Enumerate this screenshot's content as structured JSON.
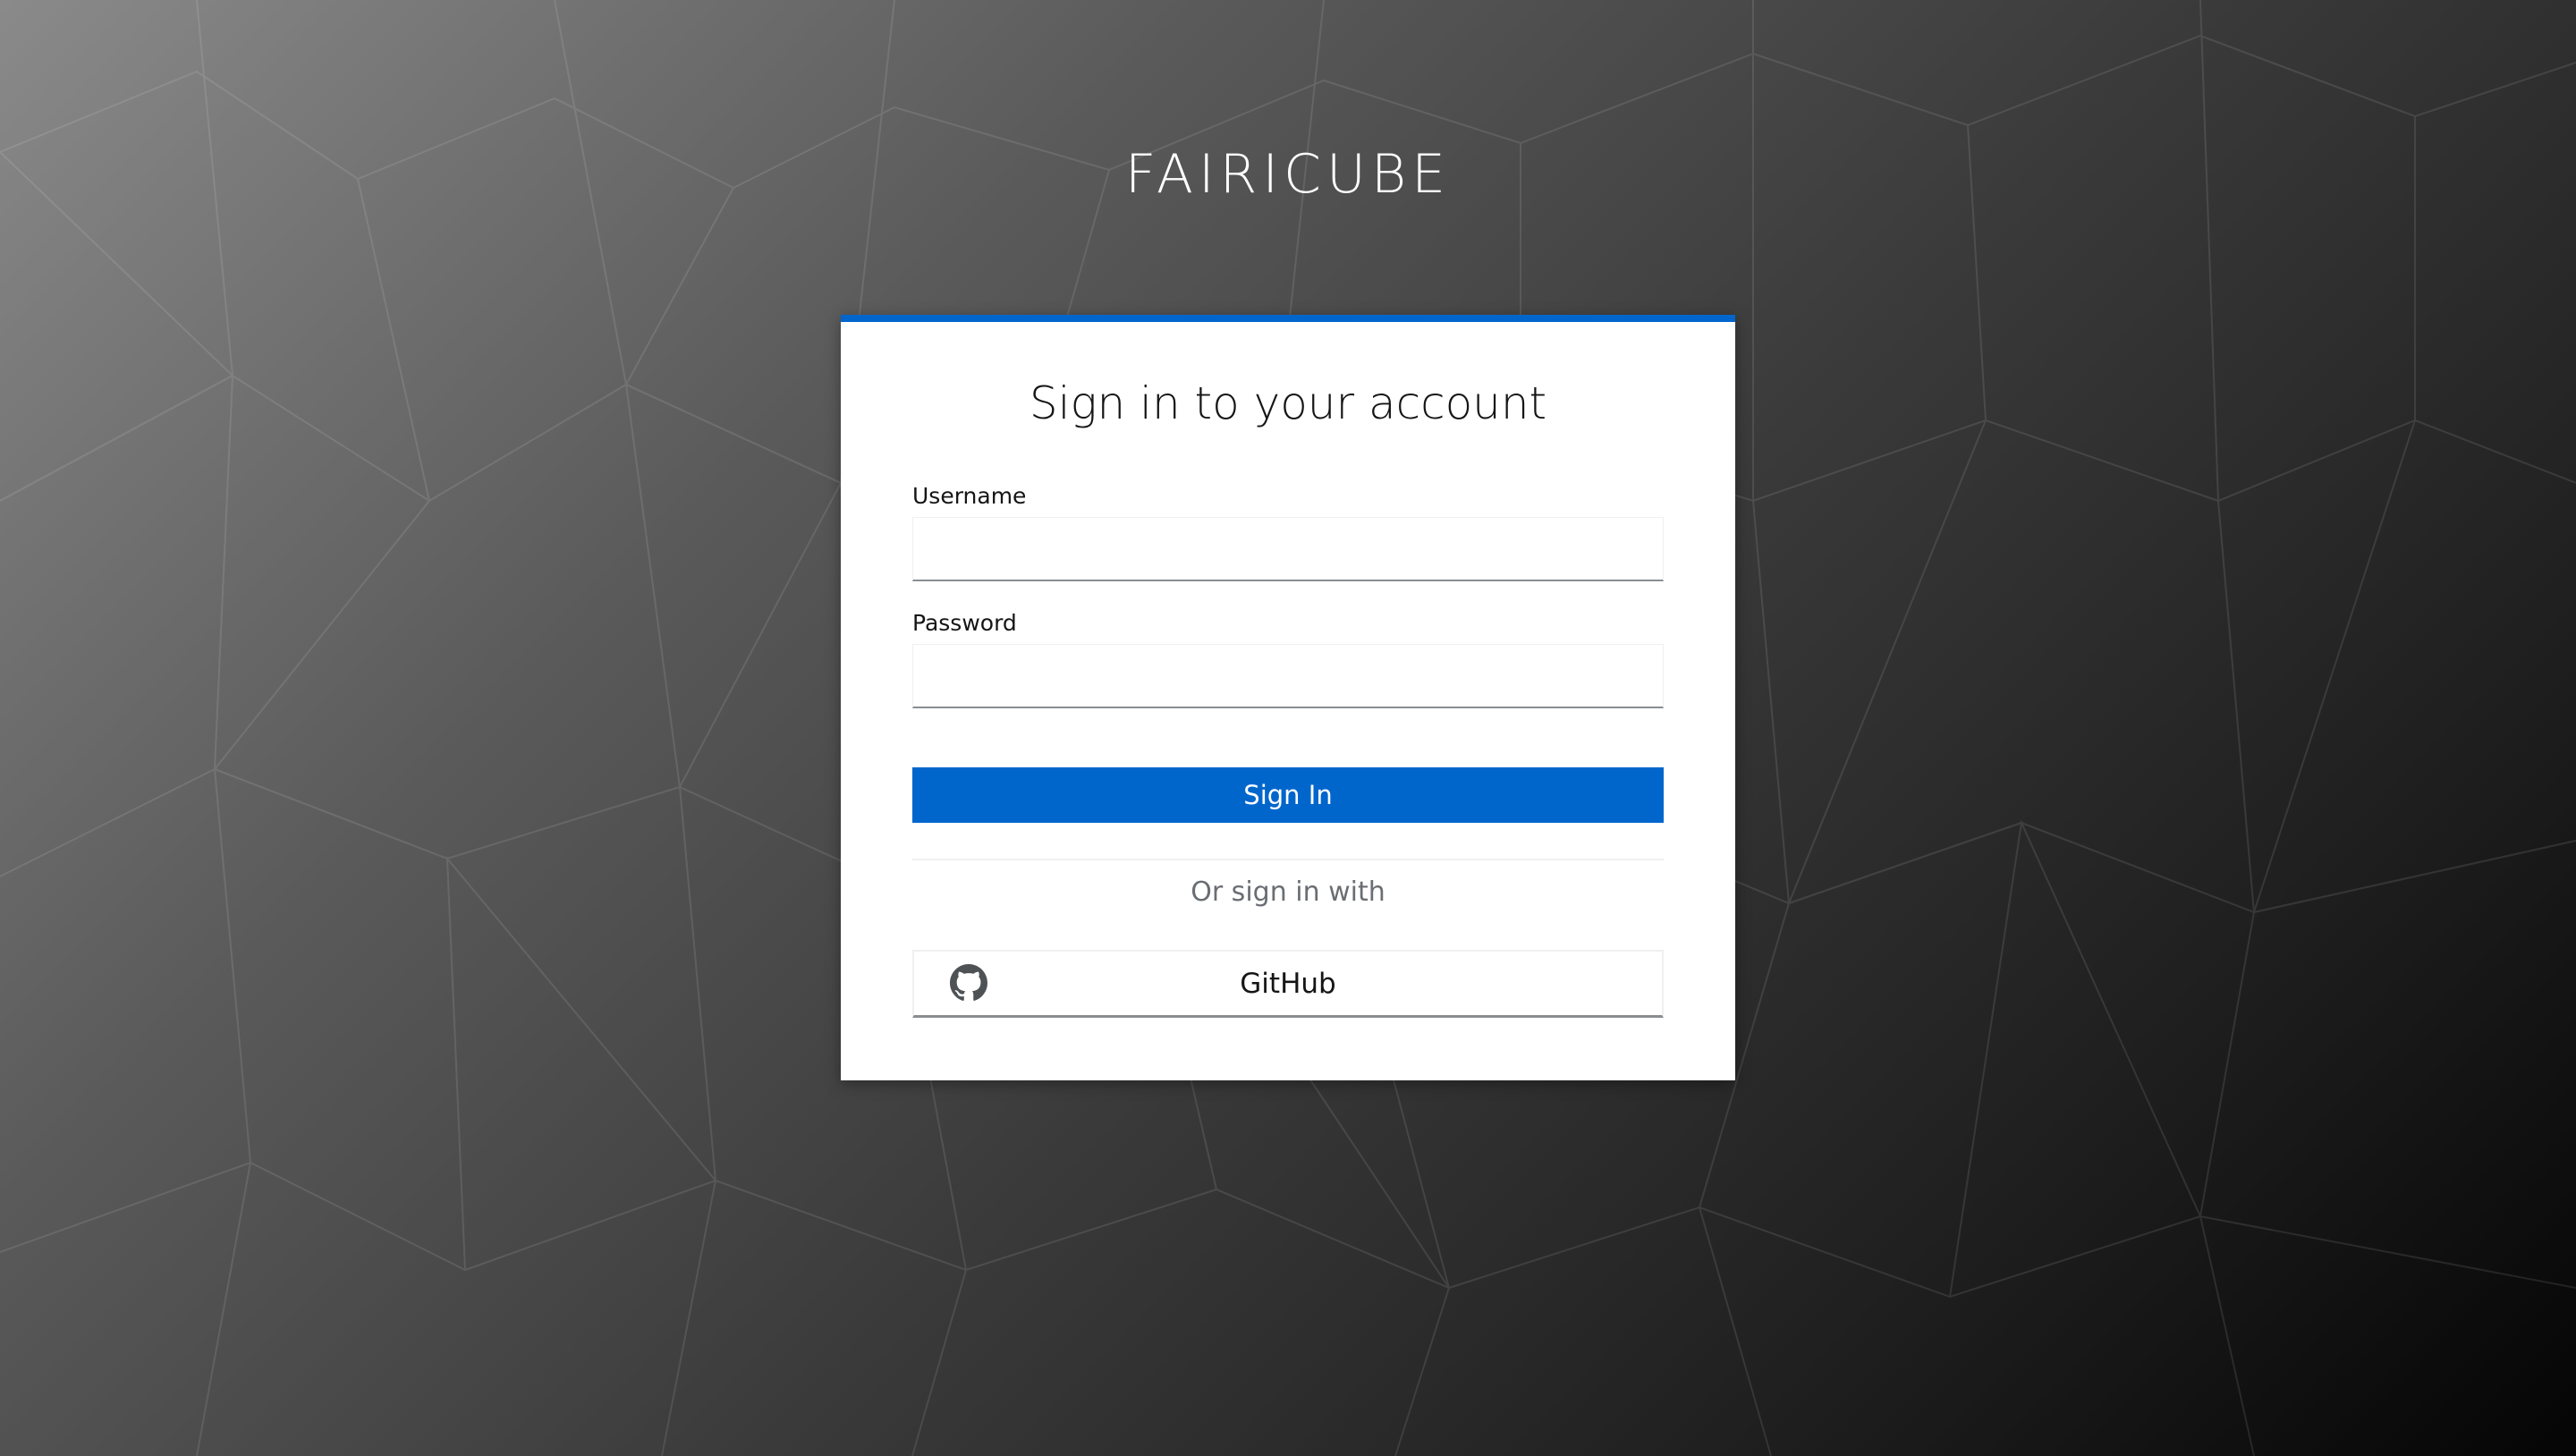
{
  "brand": {
    "name": "FAIRICUBE"
  },
  "login": {
    "title": "Sign in to your account",
    "username_label": "Username",
    "username_value": "",
    "password_label": "Password",
    "password_value": "",
    "submit_label": "Sign In",
    "social_heading": "Or sign in with",
    "providers": [
      {
        "label": "GitHub",
        "icon": "github-icon"
      }
    ]
  },
  "colors": {
    "accent": "#0066cc",
    "card_background": "#ffffff",
    "text": "#151515",
    "muted_text": "#6a6e73"
  }
}
